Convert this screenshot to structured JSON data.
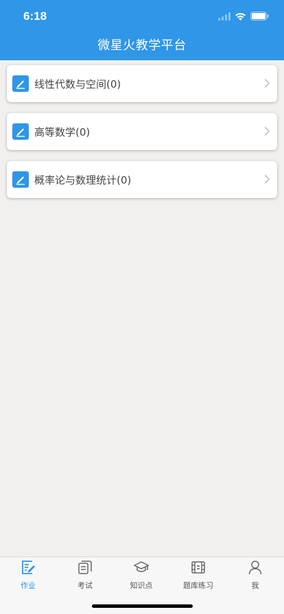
{
  "status_bar": {
    "time": "6:18"
  },
  "header": {
    "title": "微星火教学平台"
  },
  "colors": {
    "accent": "#2f96e8",
    "background": "#f1f0ef"
  },
  "courses": [
    {
      "label": "线性代数与空间(0)",
      "icon": "edit-icon"
    },
    {
      "label": "高等数学(0)",
      "icon": "edit-icon"
    },
    {
      "label": "概率论与数理统计(0)",
      "icon": "edit-icon"
    }
  ],
  "tabbar": {
    "tabs": [
      {
        "label": "作业",
        "icon": "homework-icon",
        "active": true
      },
      {
        "label": "考试",
        "icon": "exam-icon",
        "active": false
      },
      {
        "label": "知识点",
        "icon": "graduation-cap-icon",
        "active": false
      },
      {
        "label": "题库练习",
        "icon": "film-icon",
        "active": false
      },
      {
        "label": "我",
        "icon": "person-icon",
        "active": false
      }
    ]
  }
}
